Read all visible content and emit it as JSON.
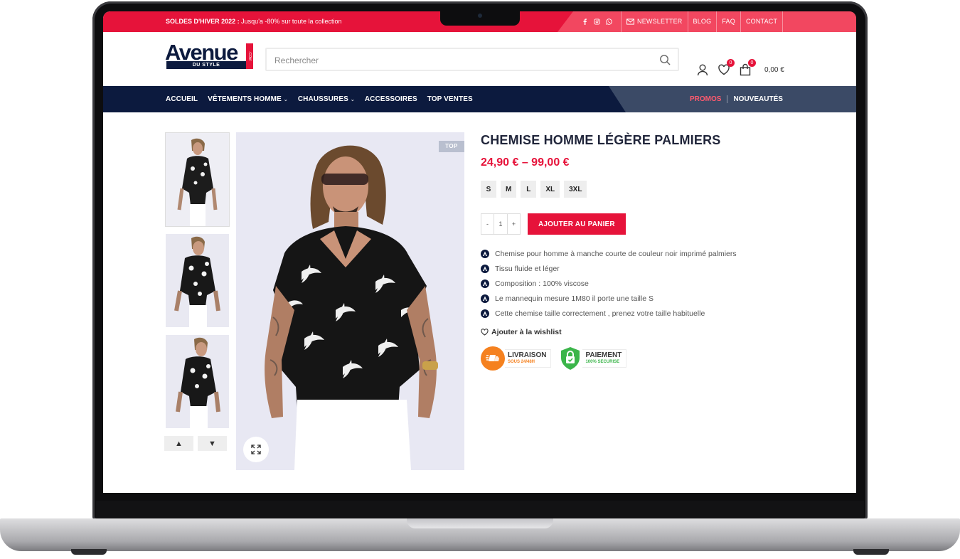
{
  "topbar": {
    "promo_bold": "SOLDES D'HIVER 2022 :",
    "promo_text": " Jusqu'a -80% sur toute la collection",
    "social": [
      "facebook-icon",
      "instagram-icon",
      "whatsapp-icon"
    ],
    "links": [
      "NEWSLETTER",
      "BLOG",
      "FAQ",
      "CONTACT"
    ]
  },
  "header": {
    "logo_word": "Avenue",
    "logo_sub": "DU STYLE",
    "logo_tag": ".COM",
    "search_placeholder": "Rechercher",
    "wishlist_count": "0",
    "cart_count": "0",
    "cart_total": "0,00 €"
  },
  "nav": {
    "items": [
      "ACCUEIL",
      "VÊTEMENTS HOMME",
      "CHAUSSURES",
      "ACCESSOIRES",
      "TOP VENTES"
    ],
    "has_dropdown": [
      false,
      true,
      true,
      false,
      false
    ],
    "promos": "PROMOS",
    "nouveautes": "NOUVEAUTÉS"
  },
  "gallery": {
    "badge": "TOP",
    "thumb_prev": "▲",
    "thumb_next": "▼"
  },
  "product": {
    "title": "CHEMISE HOMME LÉGÈRE PALMIERS",
    "price": "24,90 € – 99,00 €",
    "sizes": [
      "S",
      "M",
      "L",
      "XL",
      "3XL"
    ],
    "qty_minus": "-",
    "qty_value": "1",
    "qty_plus": "+",
    "add_to_cart": "AJOUTER AU PANIER",
    "features": [
      "Chemise pour homme  à manche courte de couleur noir imprimé palmiers",
      "Tissu fluide et léger",
      "Composition : 100% viscose",
      "Le mannequin mesure 1M80 il porte une taille S",
      "Cette chemise taille correctement , prenez votre taille habituelle"
    ],
    "wishlist": "Ajouter à la wishlist"
  },
  "trust": {
    "delivery_title": "LIVRAISON",
    "delivery_sub": "SOUS 24/48H",
    "payment_title": "PAIEMENT",
    "payment_sub": "100% SECURISE"
  },
  "colors": {
    "brand_red": "#e6133a",
    "brand_navy": "#0c1a3e",
    "nav_right": "#3b4a66",
    "delivery_orange": "#f5811f",
    "payment_green": "#3bb54a"
  }
}
